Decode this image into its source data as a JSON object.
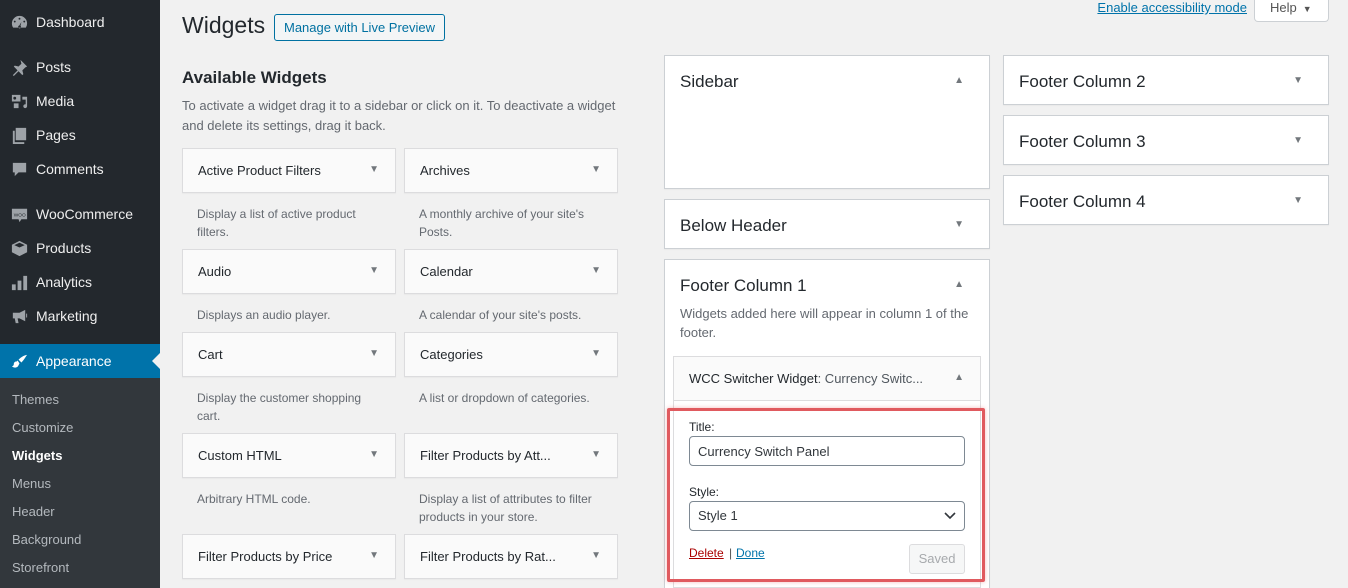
{
  "sidebar": {
    "items": [
      {
        "label": "Dashboard",
        "icon": "dashboard-icon"
      },
      {
        "label": "Posts",
        "icon": "pin-icon"
      },
      {
        "label": "Media",
        "icon": "media-icon"
      },
      {
        "label": "Pages",
        "icon": "pages-icon"
      },
      {
        "label": "Comments",
        "icon": "comment-icon"
      },
      {
        "label": "WooCommerce",
        "icon": "woo-icon"
      },
      {
        "label": "Products",
        "icon": "box-icon"
      },
      {
        "label": "Analytics",
        "icon": "bar-chart-icon"
      },
      {
        "label": "Marketing",
        "icon": "megaphone-icon"
      },
      {
        "label": "Appearance",
        "icon": "paintbrush-icon",
        "active": true
      }
    ],
    "submenu": [
      "Themes",
      "Customize",
      "Widgets",
      "Menus",
      "Header",
      "Background",
      "Storefront"
    ],
    "submenu_current": "Widgets"
  },
  "header": {
    "title": "Widgets",
    "live_preview_label": "Manage with Live Preview",
    "accessibility_link": "Enable accessibility mode",
    "help_label": "Help"
  },
  "available": {
    "title": "Available Widgets",
    "description": "To activate a widget drag it to a sidebar or click on it. To deactivate a widget and delete its settings, drag it back.",
    "widgets": [
      {
        "title": "Active Product Filters",
        "desc": "Display a list of active product filters."
      },
      {
        "title": "Archives",
        "desc": "A monthly archive of your site's Posts."
      },
      {
        "title": "Audio",
        "desc": "Displays an audio player."
      },
      {
        "title": "Calendar",
        "desc": "A calendar of your site's posts."
      },
      {
        "title": "Cart",
        "desc": "Display the customer shopping cart."
      },
      {
        "title": "Categories",
        "desc": "A list or dropdown of categories."
      },
      {
        "title": "Custom HTML",
        "desc": "Arbitrary HTML code."
      },
      {
        "title": "Filter Products by Att...",
        "desc": "Display a list of attributes to filter products in your store."
      },
      {
        "title": "Filter Products by Price",
        "desc": ""
      },
      {
        "title": "Filter Products by Rat...",
        "desc": ""
      }
    ]
  },
  "areas": {
    "sidebar": {
      "title": "Sidebar"
    },
    "below_header": {
      "title": "Below Header"
    },
    "footer1": {
      "title": "Footer Column 1",
      "description": "Widgets added here will appear in column 1 of the footer.",
      "widget": {
        "name": "WCC Switcher Widget",
        "instance": ": Currency Switc...",
        "title_label": "Title:",
        "title_value": "Currency Switch Panel",
        "style_label": "Style:",
        "style_value": "Style 1",
        "delete_label": "Delete",
        "separator": "|",
        "done_label": "Done",
        "saved_label": "Saved"
      }
    },
    "footer2": {
      "title": "Footer Column 2"
    },
    "footer3": {
      "title": "Footer Column 3"
    },
    "footer4": {
      "title": "Footer Column 4"
    }
  },
  "colors": {
    "accent": "#0073aa",
    "highlight": "#e05a5f",
    "sidebar_bg": "#23282d"
  }
}
